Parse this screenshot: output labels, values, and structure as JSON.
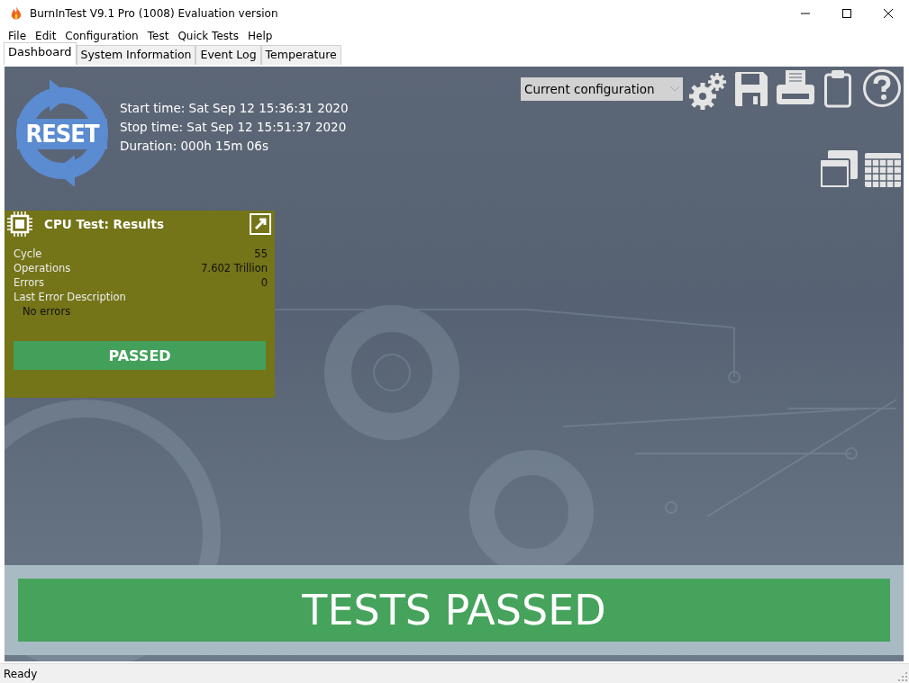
{
  "window": {
    "title": "BurnInTest V9.1 Pro (1008) Evaluation version"
  },
  "menu": [
    "File",
    "Edit",
    "Configuration",
    "Test",
    "Quick Tests",
    "Help"
  ],
  "tabs": [
    {
      "label": "Dashboard",
      "selected": true
    },
    {
      "label": "System Information",
      "selected": false
    },
    {
      "label": "Event Log",
      "selected": false
    },
    {
      "label": "Temperature",
      "selected": false
    }
  ],
  "reset_button": {
    "label": "RESET"
  },
  "times": [
    "Start time: Sat Sep 12 15:36:31 2020",
    "Stop time: Sat Sep 12 15:51:37 2020",
    "Duration: 000h 15m 06s"
  ],
  "config_select": {
    "value": "Current configuration"
  },
  "cpu_panel": {
    "title": "CPU Test: Results",
    "rows": [
      {
        "label": "Cycle",
        "value": "55"
      },
      {
        "label": "Operations",
        "value": "7.602 Trillion"
      },
      {
        "label": "Errors",
        "value": "0"
      }
    ],
    "error_label": "Last Error Description",
    "error_text": "No errors",
    "result": "PASSED"
  },
  "overall_result": "TESTS PASSED",
  "status_bar": "Ready"
}
